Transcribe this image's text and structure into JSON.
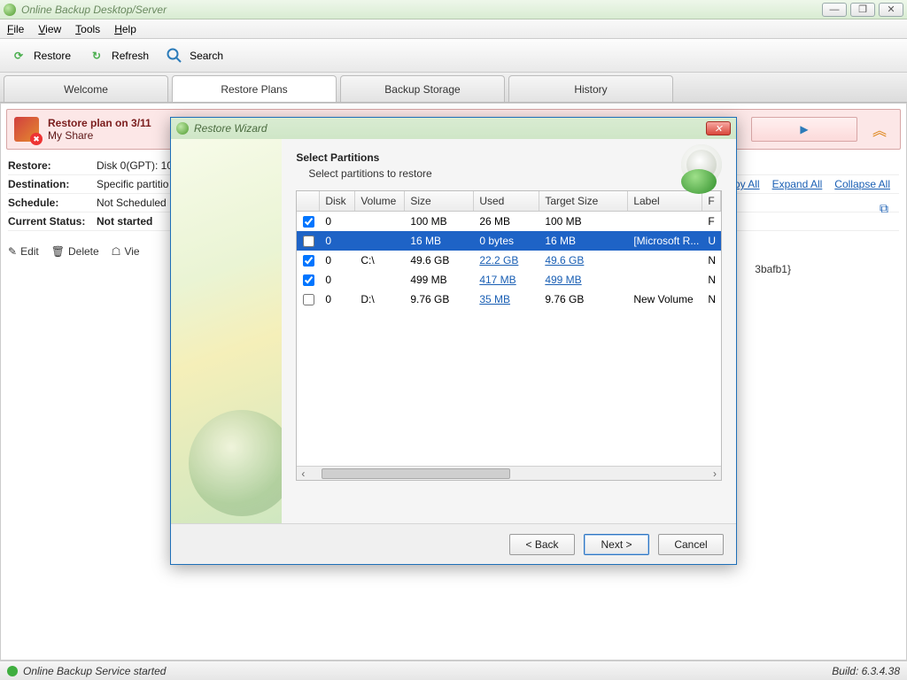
{
  "window": {
    "title": "Online Backup Desktop/Server"
  },
  "menu": {
    "file": "File",
    "view": "View",
    "tools": "Tools",
    "help": "Help"
  },
  "toolbar": {
    "restore": "Restore",
    "refresh": "Refresh",
    "search": "Search"
  },
  "tabs": {
    "welcome": "Welcome",
    "restore_plans": "Restore Plans",
    "backup_storage": "Backup Storage",
    "history": "History"
  },
  "plan": {
    "title": "Restore plan on 3/11",
    "subtitle": "My Share",
    "details": {
      "restore_k": "Restore:",
      "restore_v": "Disk 0(GPT):  10",
      "dest_k": "Destination:",
      "dest_v": "Specific partitio",
      "sched_k": "Schedule:",
      "sched_v": "Not Scheduled",
      "status_k": "Current Status:",
      "status_v": "Not started"
    },
    "actions": {
      "edit": "Edit",
      "delete": "Delete",
      "view": "Vie"
    }
  },
  "links": {
    "copy_all": "opy All",
    "expand_all": "Expand All",
    "collapse_all": "Collapse All"
  },
  "guid_suffix": "3bafb1}",
  "wizard": {
    "title": "Restore Wizard",
    "heading": "Select Partitions",
    "subheading": "Select partitions to restore",
    "columns": {
      "disk": "Disk",
      "volume": "Volume",
      "size": "Size",
      "used": "Used",
      "target": "Target Size",
      "label": "Label",
      "f": "F"
    },
    "rows": [
      {
        "checked": true,
        "disk": "0",
        "volume": "",
        "size": "100 MB",
        "used": "26 MB",
        "used_link": false,
        "target": "100 MB",
        "target_link": false,
        "label": "",
        "f": "F",
        "selected": false
      },
      {
        "checked": false,
        "disk": "0",
        "volume": "",
        "size": "16 MB",
        "used": "0 bytes",
        "used_link": false,
        "target": "16 MB",
        "target_link": false,
        "label": "[Microsoft R...",
        "f": "U",
        "selected": true
      },
      {
        "checked": true,
        "disk": "0",
        "volume": "C:\\",
        "size": "49.6 GB",
        "used": "22.2 GB",
        "used_link": true,
        "target": "49.6 GB",
        "target_link": true,
        "label": "",
        "f": "N",
        "selected": false
      },
      {
        "checked": true,
        "disk": "0",
        "volume": "",
        "size": "499 MB",
        "used": "417 MB",
        "used_link": true,
        "target": "499 MB",
        "target_link": true,
        "label": "",
        "f": "N",
        "selected": false
      },
      {
        "checked": false,
        "disk": "0",
        "volume": "D:\\",
        "size": "9.76 GB",
        "used": "35 MB",
        "used_link": true,
        "target": "9.76 GB",
        "target_link": false,
        "label": "New Volume",
        "f": "N",
        "selected": false
      }
    ],
    "buttons": {
      "back": "< Back",
      "next": "Next >",
      "cancel": "Cancel"
    }
  },
  "status": {
    "text": "Online Backup Service started",
    "build": "Build: 6.3.4.38"
  }
}
